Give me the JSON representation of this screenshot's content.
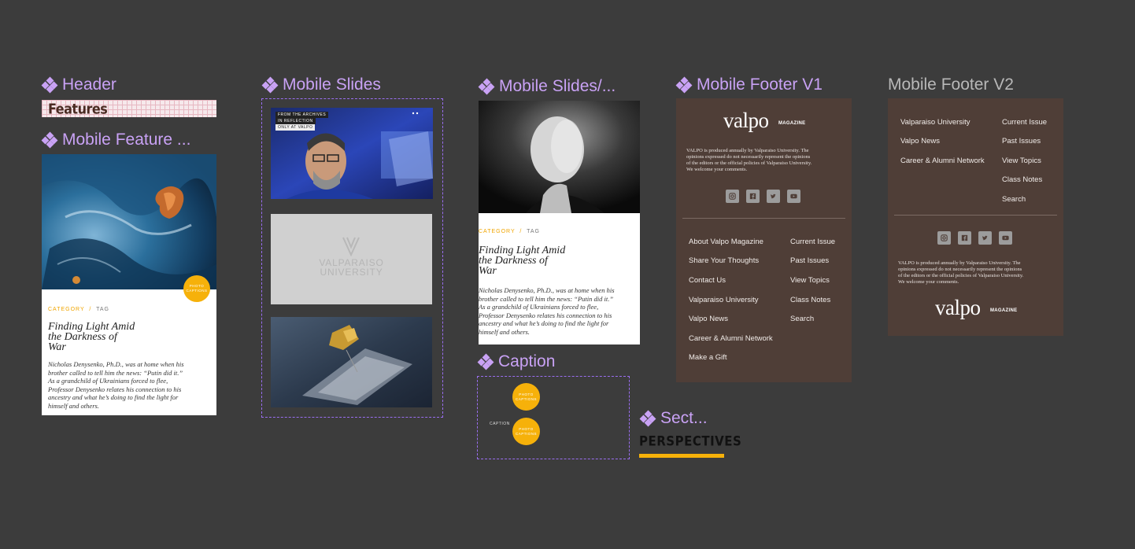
{
  "frames": {
    "header": "Header",
    "mobile_feature": "Mobile Feature ...",
    "mobile_slides": "Mobile Slides",
    "mobile_slides_2": "Mobile Slides/...",
    "caption": "Caption",
    "section": "Sect...",
    "footer_v1": "Mobile Footer V1",
    "footer_v2": "Mobile Footer V2"
  },
  "header": {
    "label": "Features"
  },
  "card": {
    "category": "CATEGORY",
    "separator": "/",
    "tag": "TAG",
    "title_lines": [
      "Finding Light Amid",
      "the Darkness of",
      "War"
    ],
    "body_lines": [
      "Nicholas Denysenko, Ph.D., was at home when his",
      "brother called to tell him the news: “Putin did it.”",
      "As a grandchild of Ukrainians forced to flee,",
      "Professor Denysenko relates his connection to his",
      "ancestry and what he’s doing to find the light for",
      "himself and others."
    ],
    "photo_caption": [
      "PHOTO",
      "CAPTIONS"
    ]
  },
  "slides": {
    "slide1_tags": [
      "FROM THE ARCHIVES",
      "IN REFLECTION",
      "ONLY AT VALPO"
    ],
    "placeholder_lines": [
      "VALPARAISO",
      "UNIVERSITY"
    ]
  },
  "caption_comp": {
    "label": "CAPTION",
    "dot_text": [
      "PHOTO",
      "CAPTIONS"
    ]
  },
  "section": {
    "label": "PERSPECTIVES"
  },
  "footer_v1": {
    "logo": "valpo",
    "logo_sub": "MAGAZINE",
    "legal_lines": [
      "VALPO is produced annually by Valparaiso University. The",
      "opinions expressed do not necessarily represent the opinions",
      "of the editors or the official policies of Valparaiso University.",
      "We welcome your comments."
    ],
    "links_left": [
      "About Valpo Magazine",
      "Share Your Thoughts",
      "Contact Us",
      "Valparaiso University",
      "Valpo News",
      "Career & Alumni Network",
      "Make a Gift"
    ],
    "links_right": [
      "Current Issue",
      "Past Issues",
      "View Topics",
      "Class Notes",
      "Search"
    ],
    "social": [
      "instagram-icon",
      "facebook-icon",
      "twitter-icon",
      "youtube-icon"
    ]
  },
  "footer_v2": {
    "links_left": [
      "Valparaiso University",
      "Valpo News",
      "Career & Alumni Network"
    ],
    "links_right": [
      "Current Issue",
      "Past Issues",
      "View Topics",
      "Class Notes",
      "Search"
    ],
    "legal_lines": [
      "VALPO is produced annually by Valparaiso University. The",
      "opinions expressed do not necessarily represent the opinions",
      "of the editors or the official policies of Valparaiso University.",
      "We welcome your comments."
    ],
    "logo": "valpo",
    "logo_sub": "MAGAZINE"
  },
  "colors": {
    "canvas": "#3c3c3c",
    "component": "#c9a2f5",
    "accent": "#f6b10a",
    "footer": "#4f3e37"
  }
}
